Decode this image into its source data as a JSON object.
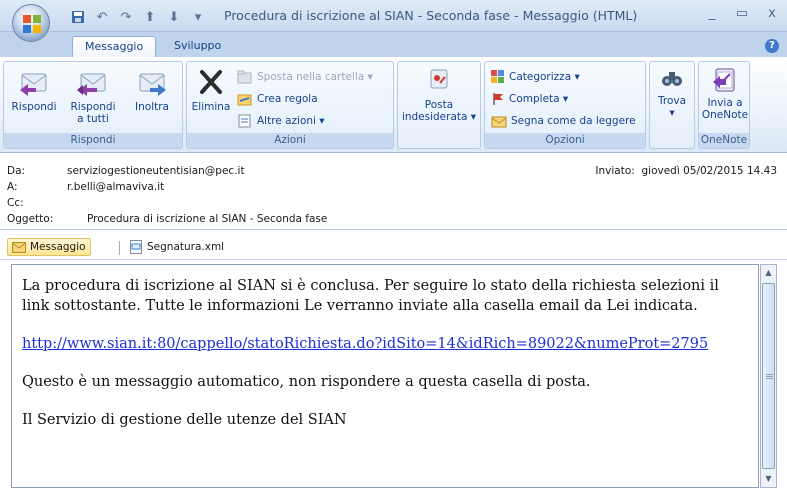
{
  "window": {
    "title": "Procedura di iscrizione al SIAN - Seconda fase - Messaggio (HTML)",
    "controls": {
      "minimize": "_",
      "maximize": "▭",
      "close": "x"
    }
  },
  "tabs": [
    {
      "label": "Messaggio",
      "active": true
    },
    {
      "label": "Sviluppo",
      "active": false
    }
  ],
  "ribbon": {
    "groups": {
      "rispondi": "Rispondi",
      "azioni": "Azioni",
      "opzioni": "Opzioni",
      "onenote": "OneNote"
    },
    "buttons": {
      "rispondi": "Rispondi",
      "rispondi_tutti_1": "Rispondi",
      "rispondi_tutti_2": "a tutti",
      "inoltra": "Inoltra",
      "elimina": "Elimina",
      "sposta": "Sposta nella cartella ▾",
      "crea_regola": "Crea regola",
      "altre_azioni": "Altre azioni ▾",
      "posta_1": "Posta",
      "posta_2": "indesiderata ▾",
      "categorizza": "Categorizza ▾",
      "completa": "Completa ▾",
      "segna_letto": "Segna come da leggere",
      "trova_1": "Trova",
      "trova_2": "▾",
      "invia_1": "Invia a",
      "invia_2": "OneNote"
    }
  },
  "headers": {
    "da_label": "Da:",
    "da_value": "serviziogestioneutentisian@pec.it",
    "a_label": "A:",
    "a_value": "r.belli@almaviva.it",
    "cc_label": "Cc:",
    "cc_value": "",
    "oggetto_label": "Oggetto:",
    "oggetto_value": "Procedura di iscrizione al SIAN - Seconda fase",
    "inviato_label": "Inviato:",
    "inviato_value": "giovedì 05/02/2015 14.43"
  },
  "attachments": [
    {
      "label": "Messaggio",
      "selected": true
    },
    {
      "label": "Segnatura.xml",
      "selected": false
    }
  ],
  "body": {
    "para1": "La procedura di iscrizione al SIAN si è conclusa. Per seguire lo stato della richiesta selezioni il link sottostante. Tutte le informazioni Le verranno inviate alla casella email da Lei indicata.",
    "link": "http://www.sian.it:80/cappello/statoRichiesta.do?idSito=14&idRich=89022&numeProt=2795",
    "para2": "Questo è un messaggio automatico, non rispondere a questa casella di posta.",
    "para3": "Il Servizio di gestione delle utenze del SIAN"
  },
  "colors": {
    "accent": "#15428b",
    "link": "#1d2fd6",
    "ribbon_bg": "#dce8f6"
  }
}
